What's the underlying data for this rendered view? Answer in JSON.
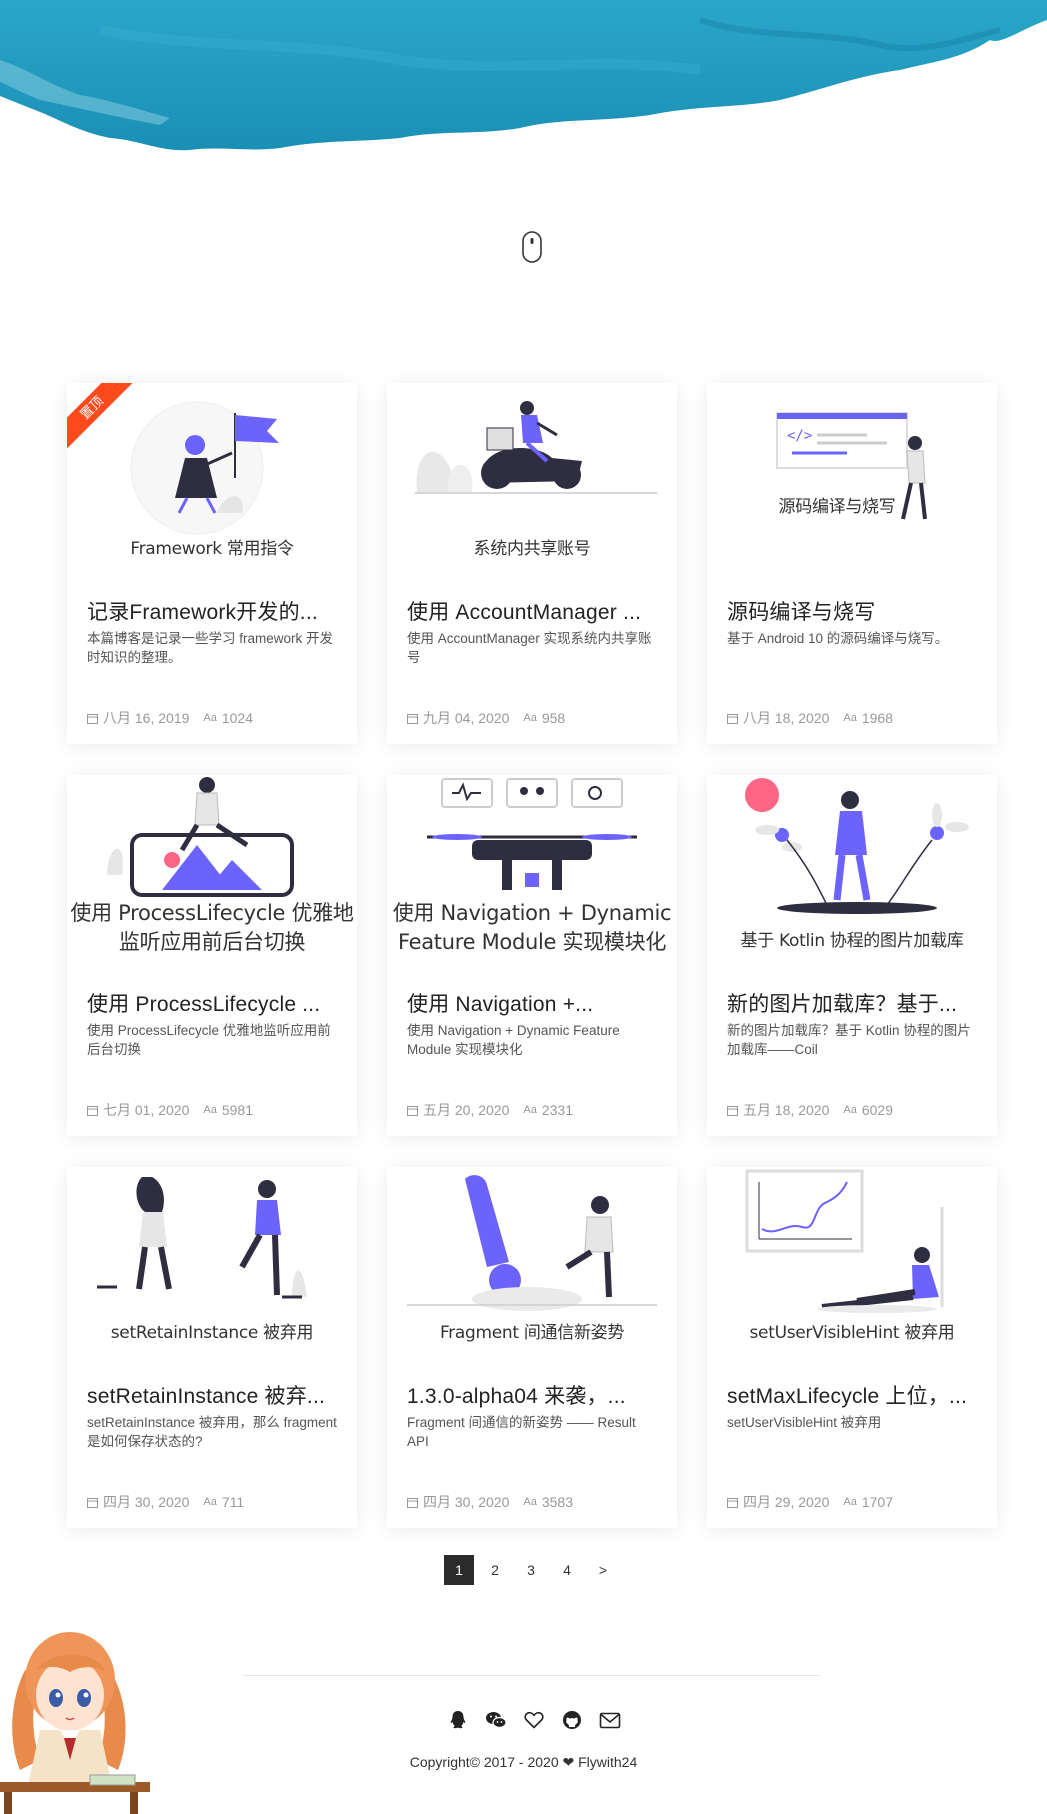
{
  "cards": [
    {
      "thumb_caption": "Framework 常用指令",
      "title": "记录Framework开发的...",
      "desc": "本篇博客是记录一些学习 framework 开发时知识的整理。",
      "date": "八月 16, 2019",
      "views": "1024",
      "pin_label": "置顶"
    },
    {
      "thumb_caption": "系统内共享账号",
      "title": "使用 AccountManager ...",
      "desc": "使用 AccountManager 实现系统内共享账号",
      "date": "九月 04, 2020",
      "views": "958"
    },
    {
      "thumb_caption": "源码编译与烧写",
      "title": "源码编译与烧写",
      "desc": "基于 Android 10 的源码编译与烧写。",
      "date": "八月 18, 2020",
      "views": "1968"
    },
    {
      "thumb_caption": "使用 ProcessLifecycle 优雅地监听应用前后台切换",
      "title": "使用 ProcessLifecycle ...",
      "desc": "使用 ProcessLifecycle 优雅地监听应用前后台切换",
      "date": "七月 01, 2020",
      "views": "5981"
    },
    {
      "thumb_caption": "使用 Navigation + Dynamic Feature Module 实现模块化",
      "title": "使用 Navigation +...",
      "desc": "使用 Navigation + Dynamic Feature Module 实现模块化",
      "date": "五月 20, 2020",
      "views": "2331"
    },
    {
      "thumb_caption": "基于 Kotlin 协程的图片加载库",
      "title": "新的图片加载库？基于...",
      "desc": "新的图片加载库？基于 Kotlin 协程的图片加载库——Coil",
      "date": "五月 18, 2020",
      "views": "6029"
    },
    {
      "thumb_caption": "setRetainInstance 被弃用",
      "title": "setRetainInstance 被弃...",
      "desc": "setRetainInstance 被弃用，那么 fragment 是如何保存状态的?",
      "date": "四月 30, 2020",
      "views": "711"
    },
    {
      "thumb_caption": "Fragment 间通信新姿势",
      "title": "1.3.0-alpha04 来袭，...",
      "desc": "Fragment 间通信的新姿势 —— Result API",
      "date": "四月 30, 2020",
      "views": "3583"
    },
    {
      "thumb_caption": "setUserVisibleHint 被弃用",
      "title": "setMaxLifecycle 上位，...",
      "desc": "setUserVisibleHint 被弃用",
      "date": "四月 29, 2020",
      "views": "1707"
    }
  ],
  "pagination": {
    "pages": [
      "1",
      "2",
      "3",
      "4"
    ],
    "current": "1",
    "next_label": ">"
  },
  "footer": {
    "social_icons": [
      "qq-icon",
      "wechat-icon",
      "heart-icon",
      "github-icon",
      "mail-icon"
    ],
    "copyright": "Copyright© 2017 - 2020 ❤ Flywith24"
  },
  "colors": {
    "accent": "#6c63ff",
    "pin": "#ff4a1c",
    "hero_blue": "#1e9dbf"
  }
}
